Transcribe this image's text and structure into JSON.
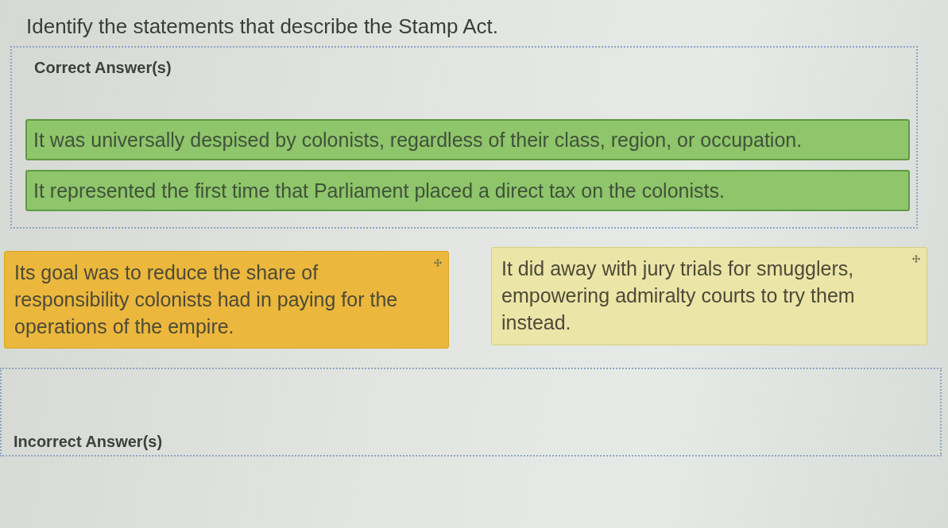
{
  "question": {
    "text": "Identify the statements that describe the Stamp Act."
  },
  "correct_zone": {
    "label": "Correct Answer(s)",
    "answers": [
      {
        "text": "It was universally despised by colonists, regardless of their class, region, or occupation."
      },
      {
        "text": "It represented the first time that Parliament placed a direct tax on the colonists."
      }
    ]
  },
  "choices": [
    {
      "text": "Its goal was to reduce the share of responsibility colonists had in paying for the operations of the empire.",
      "selected": true
    },
    {
      "text": "It did away with jury trials for smugglers, empowering admiralty courts to try them instead.",
      "selected": false
    }
  ],
  "incorrect_zone": {
    "label": "Incorrect Answer(s)"
  }
}
